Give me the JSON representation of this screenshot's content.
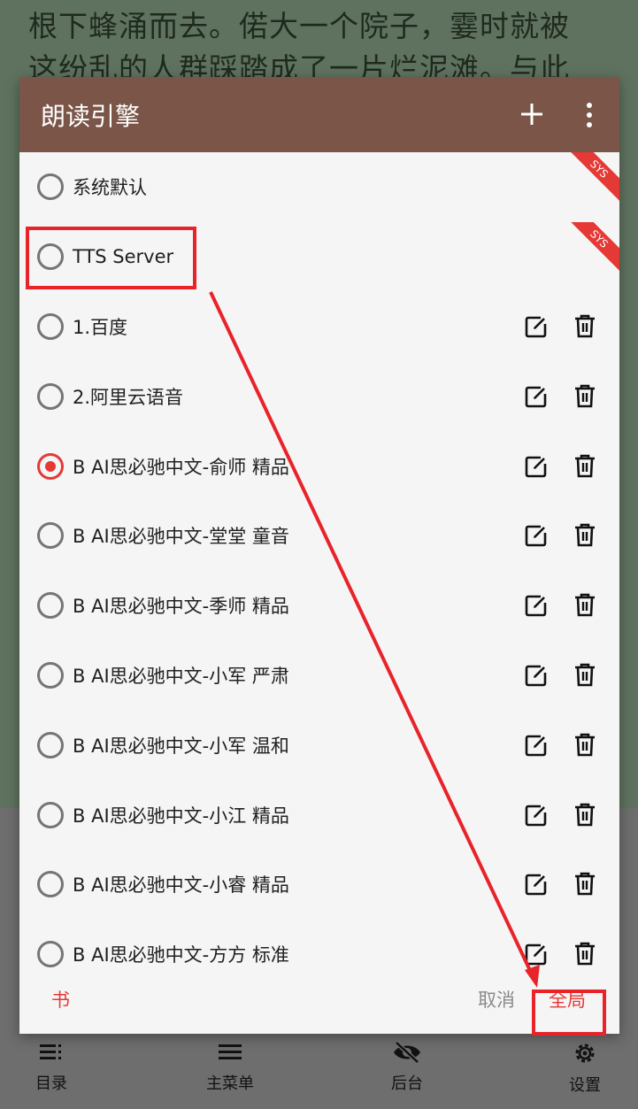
{
  "background_text": "根下蜂涌而去。偌大一个院子，霎时就被\n这纷乱的人群踩踏成了一片烂泥滩。与此",
  "dialog": {
    "title": "朗读引擎",
    "icons": {
      "add": "plus-icon",
      "more": "more-vert-icon",
      "edit": "edit-icon",
      "delete": "trash-icon"
    },
    "sys_badge": "SYS",
    "engines": [
      {
        "label": "系统默认",
        "selected": false,
        "sys": true
      },
      {
        "label": "TTS Server",
        "selected": false,
        "sys": true
      },
      {
        "label": "1.百度",
        "selected": false,
        "sys": false
      },
      {
        "label": "2.阿里云语音",
        "selected": false,
        "sys": false
      },
      {
        "label": "B AI思必驰中文-俞师 精品",
        "selected": true,
        "sys": false
      },
      {
        "label": "B AI思必驰中文-堂堂 童音",
        "selected": false,
        "sys": false
      },
      {
        "label": "B AI思必驰中文-季师 精品",
        "selected": false,
        "sys": false
      },
      {
        "label": "B AI思必驰中文-小军 严肃",
        "selected": false,
        "sys": false
      },
      {
        "label": "B AI思必驰中文-小军 温和",
        "selected": false,
        "sys": false
      },
      {
        "label": "B AI思必驰中文-小江 精品",
        "selected": false,
        "sys": false
      },
      {
        "label": "B AI思必驰中文-小睿 精品",
        "selected": false,
        "sys": false
      },
      {
        "label": "B AI思必驰中文-方方 标准",
        "selected": false,
        "sys": false
      }
    ],
    "footer": {
      "book": "书",
      "cancel": "取消",
      "global": "全局"
    }
  },
  "bottom_nav": [
    {
      "label": "目录",
      "icon": "toc-icon"
    },
    {
      "label": "主菜单",
      "icon": "menu-icon"
    },
    {
      "label": "后台",
      "icon": "eye-off-icon"
    },
    {
      "label": "设置",
      "icon": "gear-icon"
    }
  ],
  "colors": {
    "header": "#7a5548",
    "accent": "#e53935",
    "annotation": "#e8232a"
  }
}
